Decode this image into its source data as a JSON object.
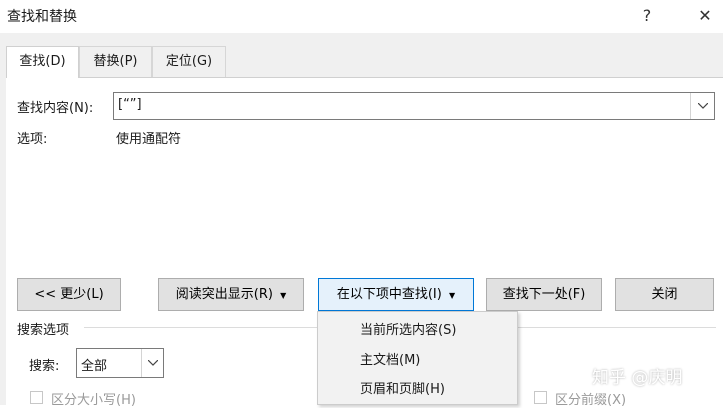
{
  "window": {
    "title": "查找和替换",
    "help_glyph": "?",
    "close_glyph": "✕"
  },
  "tabs": [
    {
      "label": "查找(D)"
    },
    {
      "label": "替换(P)"
    },
    {
      "label": "定位(G)"
    }
  ],
  "find": {
    "label": "查找内容(N):",
    "value": "[“”]",
    "options_label": "选项:",
    "options_value": "使用通配符"
  },
  "buttons": {
    "less": "<< 更少(L)",
    "reading_highlight": "阅读突出显示(R)",
    "find_in": "在以下项中查找(I)",
    "find_next": "查找下一处(F)",
    "close": "关闭"
  },
  "dropdown_menu": {
    "items": [
      "当前所选内容(S)",
      "主文档(M)",
      "页眉和页脚(H)"
    ]
  },
  "search_options": {
    "heading": "搜索选项",
    "search_label": "搜索:",
    "search_value": "全部",
    "match_case": "区分大小写(H)",
    "match_prefix": "区分前缀(X)"
  },
  "watermark": "知乎 @庆明",
  "colors": {
    "focus_border": "#0078d7",
    "focus_fill": "#e5f1fb",
    "button_fill": "#e1e1e1",
    "panel_bg": "#f0f0f0"
  }
}
